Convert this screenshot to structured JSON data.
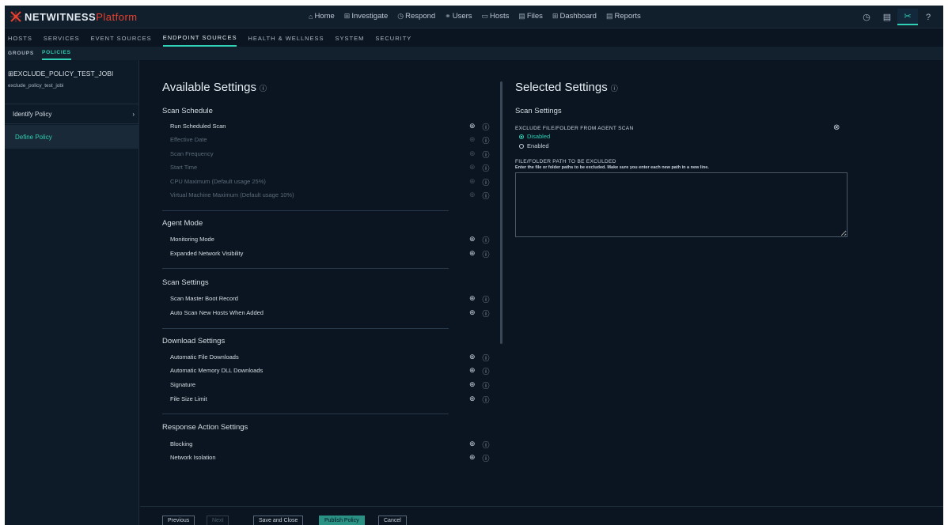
{
  "app": {
    "brand_name": "NETWITNESS",
    "brand_suffix": "Platform"
  },
  "main_nav": [
    {
      "label": "Home",
      "icon": "⌂"
    },
    {
      "label": "Investigate",
      "icon": "⊞"
    },
    {
      "label": "Respond",
      "icon": "◷"
    },
    {
      "label": "Users",
      "icon": "⚭"
    },
    {
      "label": "Hosts",
      "icon": "▭"
    },
    {
      "label": "Files",
      "icon": "▤"
    },
    {
      "label": "Dashboard",
      "icon": "⊞"
    },
    {
      "label": "Reports",
      "icon": "▤"
    }
  ],
  "tool_icons": [
    "timer-icon",
    "notes-icon",
    "admin-tools-icon",
    "help-icon"
  ],
  "sub_nav": [
    "HOSTS",
    "SERVICES",
    "EVENT SOURCES",
    "ENDPOINT SOURCES",
    "HEALTH & WELLNESS",
    "SYSTEM",
    "SECURITY"
  ],
  "sub_sub_nav": [
    "GROUPS",
    "POLICIES"
  ],
  "sidebar": {
    "title": "EXCLUDE_POLICY_TEST_JOBI",
    "subtitle": "exclude_policy_test_jobi",
    "items": [
      "Identify Policy",
      "Define Policy"
    ]
  },
  "available": {
    "title": "Available Settings",
    "sections": [
      {
        "name": "Scan Schedule",
        "rows": [
          {
            "label": "Run Scheduled Scan",
            "enabled": true
          },
          {
            "label": "Effective Date",
            "enabled": false
          },
          {
            "label": "Scan Frequency",
            "enabled": false
          },
          {
            "label": "Start Time",
            "enabled": false
          },
          {
            "label": "CPU Maximum (Default usage 25%)",
            "enabled": false
          },
          {
            "label": "Virtual Machine Maximum (Default usage 10%)",
            "enabled": false
          }
        ]
      },
      {
        "name": "Agent Mode",
        "rows": [
          {
            "label": "Monitoring Mode",
            "enabled": true
          },
          {
            "label": "Expanded Network Visibility",
            "enabled": true
          }
        ]
      },
      {
        "name": "Scan Settings",
        "rows": [
          {
            "label": "Scan Master Boot Record",
            "enabled": true
          },
          {
            "label": "Auto Scan New Hosts When Added",
            "enabled": true
          }
        ]
      },
      {
        "name": "Download Settings",
        "rows": [
          {
            "label": "Automatic File Downloads",
            "enabled": true
          },
          {
            "label": "Automatic Memory DLL Downloads",
            "enabled": true
          },
          {
            "label": "Signature",
            "enabled": true
          },
          {
            "label": "File Size Limit",
            "enabled": true
          }
        ]
      },
      {
        "name": "Response Action Settings",
        "rows": [
          {
            "label": "Blocking",
            "enabled": true
          },
          {
            "label": "Network Isolation",
            "enabled": true
          }
        ]
      }
    ]
  },
  "selected": {
    "title": "Selected Settings",
    "section": "Scan Settings",
    "exclude_label": "EXCLUDE FILE/FOLDER FROM AGENT SCAN",
    "radio_disabled": "Disabled",
    "radio_enabled": "Enabled",
    "path_label": "FILE/FOLDER PATH TO BE EXCULDED",
    "path_hint": "Enter the file or folder paths to be excluded. Make sure you enter each new path in a new line.",
    "path_value": ""
  },
  "footer": {
    "previous": "Previous",
    "next": "Next",
    "save_close": "Save and Close",
    "publish": "Publish Policy",
    "cancel": "Cancel"
  },
  "colors": {
    "accent": "#2fd0b5",
    "brand_red": "#e8412f",
    "background": "#0a1521"
  }
}
